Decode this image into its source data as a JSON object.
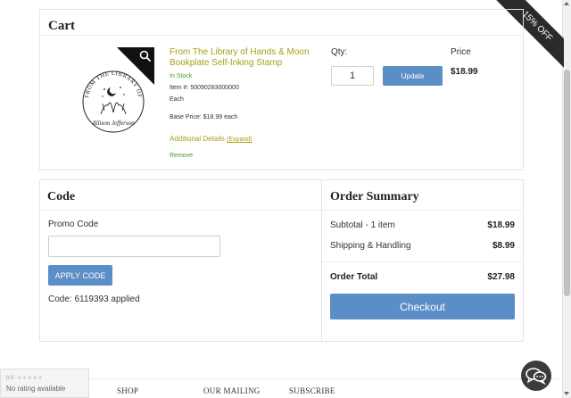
{
  "ribbon": {
    "label": "15% OFF"
  },
  "cart": {
    "title": "Cart",
    "item": {
      "image_alt": "From The Library of Allison Jefferson stamp design",
      "image_text_top": "FROM THE LIBRARY OF",
      "image_text_name": "Allison Jefferson",
      "name": "From The Library of Hands & Moon Bookplate Self-Inking Stamp",
      "stock": "In Stock",
      "item_number": "Item #: 50090283000000",
      "unit": "Each",
      "base_price": "Base Price: $18.99 each",
      "additional_details": "Additional Details",
      "expand": "(Expand)",
      "remove": "Remove",
      "qty_label": "Qty:",
      "qty_value": "1",
      "update_label": "Update",
      "price_label": "Price",
      "price_value": "$18.99"
    }
  },
  "code": {
    "title": "Code",
    "promo_label": "Promo Code",
    "promo_value": "",
    "apply_label": "APPLY CODE",
    "applied_text": "Code: 6119393 applied"
  },
  "summary": {
    "title": "Order Summary",
    "subtotal_label": "Subtotal - 1 item",
    "subtotal_value": "$18.99",
    "shipping_label": "Shipping & Handling",
    "shipping_value": "$8.99",
    "total_label": "Order Total",
    "total_value": "$27.98",
    "checkout_label": "Checkout"
  },
  "footer": {
    "links": [
      "SHOP",
      "OUR MAILING",
      "SUBSCRIBE"
    ]
  },
  "rating_widget": {
    "score": "0.0",
    "stars": "★★★★★",
    "text": "No rating available"
  },
  "icons": {
    "zoom": "magnifier-icon",
    "chat": "chat-icon"
  },
  "colors": {
    "accent": "#5b8ec6",
    "product_name": "#a7a017",
    "stock": "#3e9b2b"
  }
}
